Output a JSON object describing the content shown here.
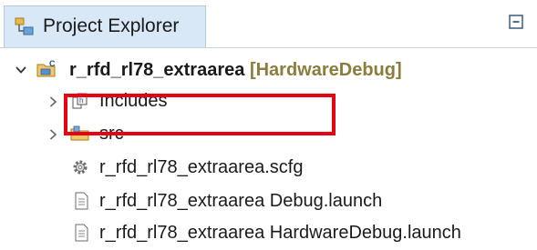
{
  "panel": {
    "title": "Project Explorer",
    "title_icon": "project-explorer-icon",
    "collapse_icon": "collapse-all-icon"
  },
  "tree": {
    "project": {
      "name": "r_rfd_rl78_extraarea",
      "decoration": "[HardwareDebug]",
      "expanded": true,
      "icon": "c-project-icon"
    },
    "items": [
      {
        "label": "Includes",
        "icon": "includes-icon",
        "expandable": true
      },
      {
        "label": "src",
        "icon": "source-folder-icon",
        "expandable": true
      },
      {
        "label": "r_rfd_rl78_extraarea.scfg",
        "icon": "gear-config-icon",
        "highlighted": true
      },
      {
        "label": "r_rfd_rl78_extraarea Debug.launch",
        "icon": "launch-file-icon"
      },
      {
        "label": "r_rfd_rl78_extraarea HardwareDebug.launch",
        "icon": "launch-file-icon"
      }
    ]
  },
  "colors": {
    "highlight_border": "#e60012",
    "tab_background": "#d8e8f7",
    "decoration_text": "#8a7c3c"
  }
}
